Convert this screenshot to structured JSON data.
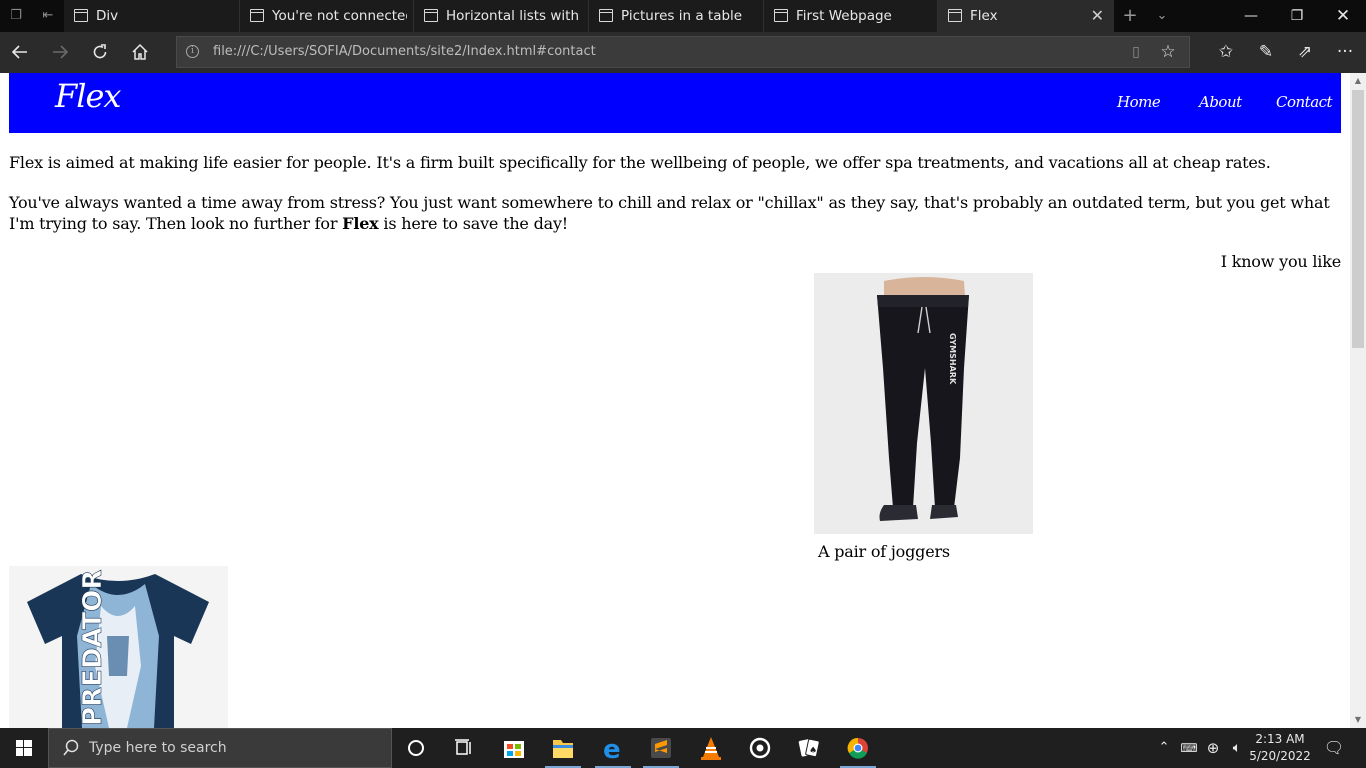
{
  "browser": {
    "tabs": [
      {
        "label": "Div"
      },
      {
        "label": "You're not connected"
      },
      {
        "label": "Horizontal lists with CS"
      },
      {
        "label": "Pictures in a table"
      },
      {
        "label": "First Webpage"
      },
      {
        "label": "Flex",
        "active": true
      }
    ],
    "url": "file:///C:/Users/SOFIA/Documents/site2/Index.html#contact"
  },
  "page": {
    "logo": "Flex",
    "nav": [
      "Home",
      "About",
      "Contact"
    ],
    "paragraph1": "Flex is aimed at making life easier for people. It's a firm built specifically for the wellbeing of people, we offer spa treatments, and vacations all at cheap rates.",
    "paragraph2_before": "You've always wanted a time away from stress? You just want somewhere to chill and relax or \"chillax\" as they say, that's probably an outdated term, but you get what I'm trying to say. Then look no further for ",
    "paragraph2_bold": "Flex",
    "paragraph2_after": " is here to save the day!",
    "right_text": "I know you like",
    "joggers_caption": "A pair of joggers",
    "joggers_brand": "GYMSHARK",
    "shirt_text": "PREDATOR"
  },
  "taskbar": {
    "search_placeholder": "Type here to search",
    "time": "2:13 AM",
    "date": "5/20/2022"
  }
}
